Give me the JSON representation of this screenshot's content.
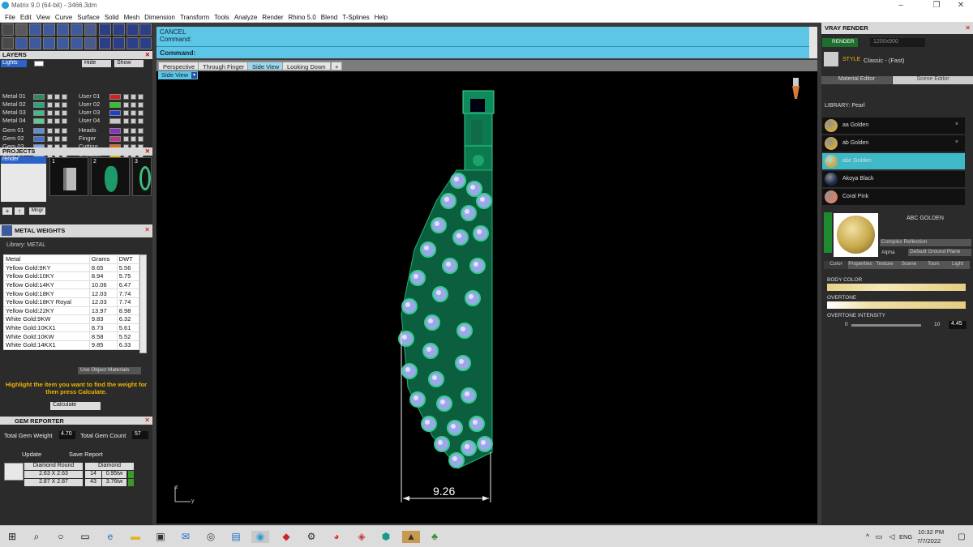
{
  "window": {
    "title": "Matrix 9.0 (64-bit) - 3466.3dm",
    "controls": [
      "–",
      "❐",
      "✕"
    ]
  },
  "menu": [
    "File",
    "Edit",
    "View",
    "Curve",
    "Surface",
    "Solid",
    "Mesh",
    "Dimension",
    "Transform",
    "Tools",
    "Analyze",
    "Render",
    "Rhino 5.0",
    "Blend",
    "T-Splines",
    "Help"
  ],
  "layers": {
    "title": "LAYERS",
    "lights_label": "Lights",
    "hide_label": "Hide",
    "show_label": "Show",
    "left_items": [
      {
        "label": "Metal 01",
        "color": "#2e8b57"
      },
      {
        "label": "Metal 02",
        "color": "#1faa7a"
      },
      {
        "label": "Metal 03",
        "color": "#3dbb88"
      },
      {
        "label": "Metal 04",
        "color": "#55d08f"
      },
      {
        "label": "Gem 01",
        "color": "#5b8fd9"
      },
      {
        "label": "Gem 02",
        "color": "#3d73d6"
      },
      {
        "label": "Gem 03",
        "color": "#7aa8e8"
      },
      {
        "label": "Gem 04",
        "color": "#9bc0ee"
      }
    ],
    "right_items": [
      {
        "label": "User 01",
        "color": "#d22222"
      },
      {
        "label": "User 02",
        "color": "#22cc22"
      },
      {
        "label": "User 03",
        "color": "#1f3fd0"
      },
      {
        "label": "User 04",
        "color": "#c9c9c9"
      },
      {
        "label": "Heads",
        "color": "#8a2fc8"
      },
      {
        "label": "Finger",
        "color": "#c72e8a"
      },
      {
        "label": "Cutting",
        "color": "#e06a1f"
      },
      {
        "label": "Creation",
        "color": "#e0b41f"
      }
    ]
  },
  "projects": {
    "title": "PROJECTS",
    "selected": "render",
    "thumb_numbers": [
      "1",
      "2",
      "3"
    ],
    "mngr_label": "Mngr"
  },
  "metal_weights": {
    "title": "METAL WEIGHTS",
    "library_label": "Library: METAL",
    "columns": [
      "Metal",
      "Grams",
      "DWT"
    ],
    "rows": [
      [
        "Yellow Gold:9KY",
        "8.65",
        "5.56"
      ],
      [
        "Yellow Gold:10KY",
        "8.94",
        "5.75"
      ],
      [
        "Yellow Gold:14KY",
        "10.06",
        "6.47"
      ],
      [
        "Yellow Gold:18KY",
        "12.03",
        "7.74"
      ],
      [
        "Yellow Gold:18KY Royal",
        "12.03",
        "7.74"
      ],
      [
        "Yellow Gold:22KY",
        "13.97",
        "8.98"
      ],
      [
        "White Gold:9KW",
        "9.83",
        "6.32"
      ],
      [
        "White Gold:10KX1",
        "8.73",
        "5.61"
      ],
      [
        "White Gold:10KW",
        "8.58",
        "5.52"
      ],
      [
        "White Gold:14KX1",
        "9.85",
        "6.33"
      ]
    ],
    "use_object_materials": "Use Object Materials",
    "hint": "Highlight the item you want to find the weight for then press Calculate.",
    "calculate_label": "Calculate"
  },
  "gem_reporter": {
    "title": "GEM REPORTER",
    "total_weight_label": "Total Gem Weight",
    "total_weight": "4.70",
    "total_count_label": "Total Gem Count",
    "total_count": "57",
    "update_label": "Update",
    "save_label": "Save Report",
    "headers": [
      "Diamond Round",
      "Diamond"
    ],
    "rows": [
      {
        "size": "2.63 X 2.63",
        "count": "14",
        "ctw": "0.95tw"
      },
      {
        "size": "2.87 X 2.87",
        "count": "43",
        "ctw": "3.76tw"
      }
    ]
  },
  "command": {
    "line1": "CANCEL",
    "line2": "Command:",
    "prompt": "Command:"
  },
  "viewport_tabs": [
    "Perspective",
    "Through Finger",
    "Side View",
    "Looking Down",
    "+"
  ],
  "active_view": "Side View",
  "dimension": "9.26",
  "axis": {
    "z": "z",
    "y": "y"
  },
  "vray": {
    "title": "VRAY RENDER",
    "render_label": "RENDER",
    "resolution": "1200x900",
    "style_label": "STYLE",
    "style_value": "Classic - (Fast)",
    "tabs": [
      "Material Editor",
      "Scene Editor"
    ],
    "library_label": "LIBRARY: Pearl",
    "materials": [
      {
        "name": "aa Golden",
        "color": "#c9a94a"
      },
      {
        "name": "ab Golden",
        "color": "#c9a94a"
      },
      {
        "name": "abc Golden",
        "color": "#c9a94a"
      },
      {
        "name": "Akoya Black",
        "color": "#1d2a4a"
      },
      {
        "name": "Coral Pink",
        "color": "#d9826a"
      }
    ],
    "selected_material": "abc Golden",
    "preview_title": "ABC GOLDEN",
    "reflection": "Complex Reflection",
    "alpha_label": "Alpha",
    "ground_plane": "Default Ground Plane",
    "props_tabs": [
      "Color",
      "Properties",
      "Texture",
      "Scene",
      "Toon",
      "Light"
    ],
    "body_color_label": "BODY COLOR",
    "overtone_label": "OVERTONE",
    "overtone_intensity_label": "OVERTONE INTENSITY",
    "intensity_min": "0",
    "intensity_max": "10",
    "intensity_value": "4.45"
  },
  "taskbar": {
    "lang": "ENG",
    "time": "10:32 PM",
    "date": "7/7/2022"
  },
  "accent": "#5dc6e6"
}
